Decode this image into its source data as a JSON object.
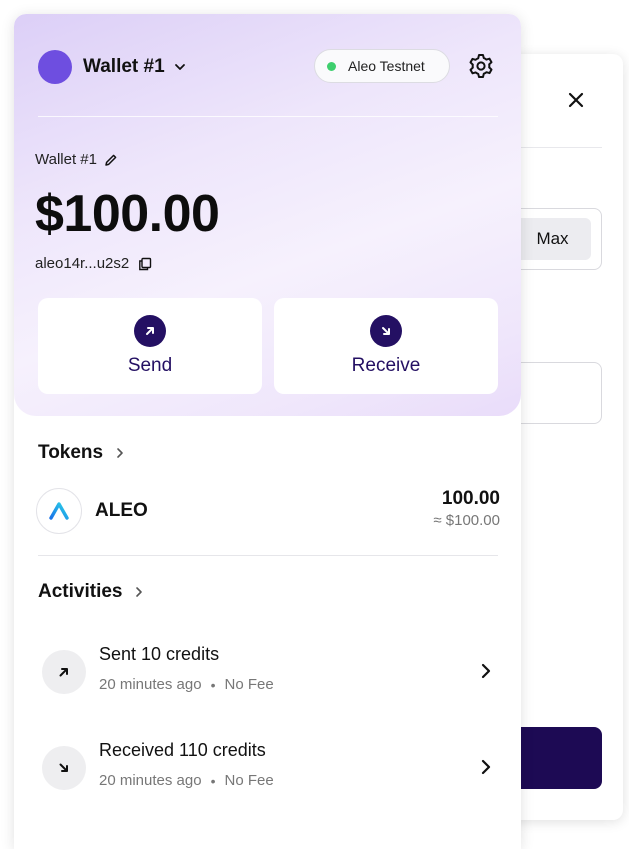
{
  "header": {
    "wallet_name": "Wallet #1",
    "network_label": "Aleo Testnet",
    "network_status_color": "#3ecf6e",
    "icons": {
      "dropdown": "chevron-down-icon",
      "settings": "gear-icon"
    }
  },
  "account": {
    "name": "Wallet #1",
    "balance": "$100.00",
    "address": "aleo14r...u2s2",
    "icons": {
      "edit": "pencil-icon",
      "copy": "copy-icon"
    }
  },
  "actions": {
    "send_label": "Send",
    "receive_label": "Receive"
  },
  "tokens": {
    "heading": "Tokens",
    "items": [
      {
        "symbol": "ALEO",
        "amount": "100.00",
        "fiat": "≈ $100.00"
      }
    ]
  },
  "activities": {
    "heading": "Activities",
    "items": [
      {
        "title": "Sent 10 credits",
        "time": "20 minutes ago",
        "fee": "No Fee",
        "direction": "sent"
      },
      {
        "title": "Received 110 credits",
        "time": "20 minutes ago",
        "fee": "No Fee",
        "direction": "received"
      }
    ]
  },
  "background_panel": {
    "max_label": "Max",
    "icons": {
      "close": "close-icon"
    }
  },
  "colors": {
    "accent": "#241063",
    "avatar": "#6e4ee0",
    "primary_button": "#1d0a54"
  }
}
